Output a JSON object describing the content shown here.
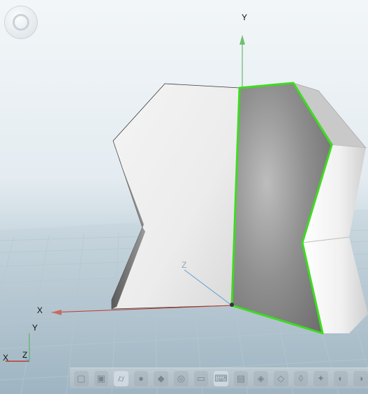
{
  "viewport": {
    "axis_labels": {
      "y_axis": "Y",
      "x_axis": "X",
      "z_axis": "Z"
    },
    "triad": {
      "y_label": "Y",
      "x_label": "X",
      "z_label": "Z"
    },
    "selection_color": "#3ddc1f",
    "axis_colors": {
      "x": "#c0392b",
      "y": "#4caf50",
      "z": "#5aa0d8"
    }
  },
  "toolbar": {
    "tools": [
      {
        "icon": "box-icon"
      },
      {
        "icon": "box-icon"
      },
      {
        "icon": "cylinder-icon",
        "active": true
      },
      {
        "icon": "sphere-icon"
      },
      {
        "icon": "cone-icon"
      },
      {
        "icon": "torus-icon"
      },
      {
        "icon": "plane-icon"
      },
      {
        "icon": "keyboard-icon",
        "active": true
      },
      {
        "icon": "text-icon"
      },
      {
        "icon": "shape-icon"
      },
      {
        "icon": "shape-icon"
      },
      {
        "icon": "shape-icon"
      },
      {
        "icon": "shape-icon"
      },
      {
        "icon": "shape-icon"
      },
      {
        "icon": "shape-icon"
      }
    ]
  }
}
